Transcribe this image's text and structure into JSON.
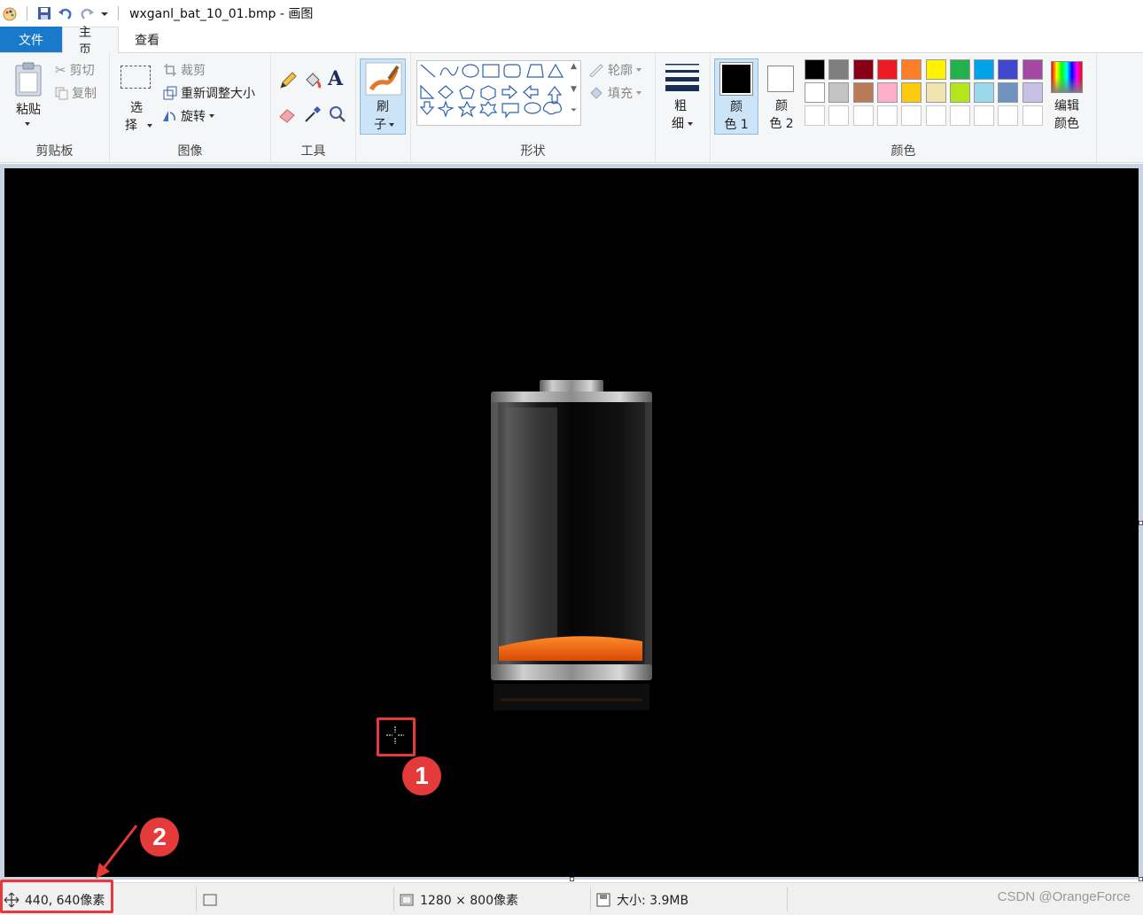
{
  "window": {
    "title": "wxganl_bat_10_01.bmp - 画图"
  },
  "tabs": [
    {
      "label": "文件"
    },
    {
      "label": "主页"
    },
    {
      "label": "查看"
    }
  ],
  "ribbon": {
    "clipboard": {
      "group_label": "剪贴板",
      "paste_label": "粘贴",
      "cut_label": "剪切",
      "copy_label": "复制"
    },
    "image": {
      "group_label": "图像",
      "select_label_1": "选",
      "select_label_2": "择",
      "crop_label": "裁剪",
      "resize_label": "重新调整大小",
      "rotate_label": "旋转"
    },
    "tools": {
      "group_label": "工具"
    },
    "brushes": {
      "label_1": "刷",
      "label_2": "子"
    },
    "shapes": {
      "group_label": "形状",
      "outline_label": "轮廓",
      "fill_label": "填充"
    },
    "size": {
      "label_1": "粗",
      "label_2": "细"
    },
    "colors": {
      "group_label": "颜色",
      "color1_label_1": "颜",
      "color1_label_2": "色 1",
      "color2_label_1": "颜",
      "color2_label_2": "色 2",
      "edit_label_1": "编辑",
      "edit_label_2": "颜色",
      "color1_value": "#000000",
      "color2_value": "#ffffff",
      "palette_row1": [
        "#000000",
        "#7f7f7f",
        "#880015",
        "#ed1c24",
        "#ff7f27",
        "#fff200",
        "#22b14c",
        "#00a2e8",
        "#3f48cc",
        "#a349a4"
      ],
      "palette_row2": [
        "#ffffff",
        "#c3c3c3",
        "#b97a57",
        "#ffaec9",
        "#ffc90e",
        "#efe4b0",
        "#b5e61d",
        "#99d9ea",
        "#7092be",
        "#c8bfe7"
      ]
    }
  },
  "status": {
    "cursor_position": "440, 640像素",
    "image_size": "1280 × 800像素",
    "file_size": "大小: 3.9MB"
  },
  "annotations": {
    "marker1": "1",
    "marker2": "2"
  },
  "watermark": "CSDN @OrangeForce"
}
